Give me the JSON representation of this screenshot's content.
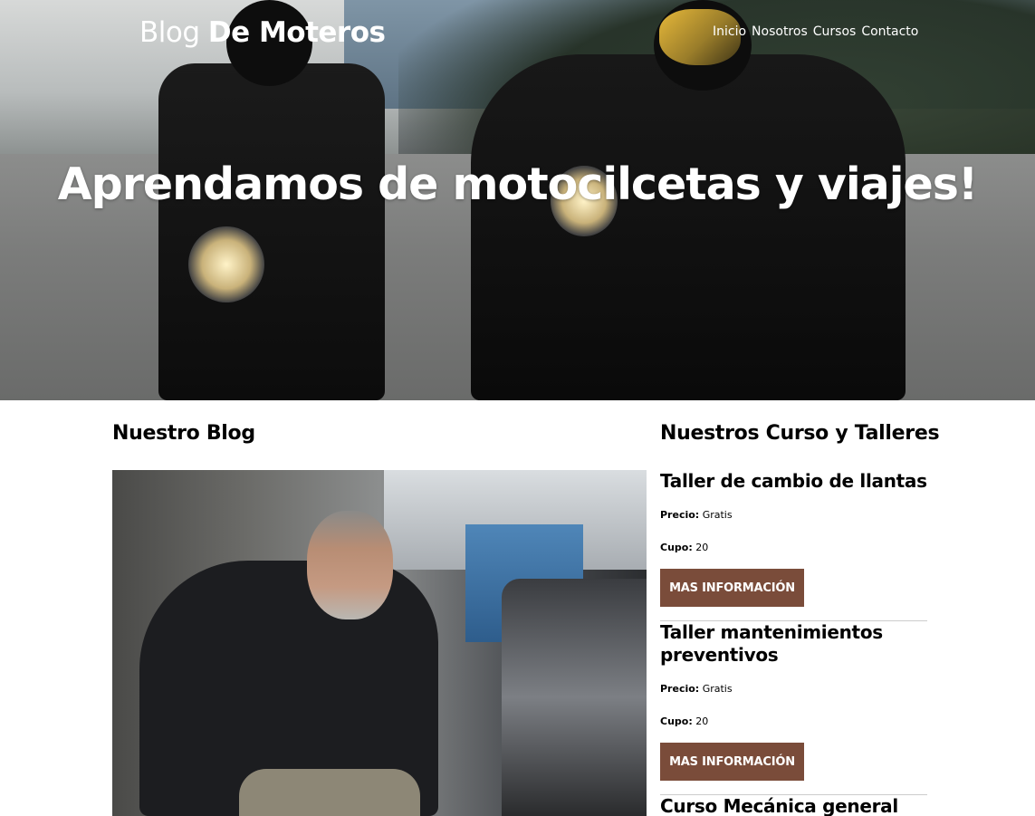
{
  "header": {
    "brand_light": "Blog ",
    "brand_bold": "De Moteros",
    "nav": [
      {
        "label": "Inicio"
      },
      {
        "label": "Nosotros"
      },
      {
        "label": "Cursos"
      },
      {
        "label": "Contacto"
      }
    ],
    "hero_title": "Aprendamos de motocilcetas y viajes!"
  },
  "blog": {
    "heading": "Nuestro Blog"
  },
  "courses": {
    "heading": "Nuestros Curso y Talleres",
    "price_label": "Precio:",
    "quota_label": "Cupo:",
    "button_label": "MAS INFORMACIÓN",
    "items": [
      {
        "title": "Taller de cambio de llantas",
        "price": "Gratis",
        "quota": "20"
      },
      {
        "title": "Taller mantenimientos preventivos",
        "price": "Gratis",
        "quota": "20"
      },
      {
        "title": "Curso Mecánica general"
      }
    ]
  },
  "colors": {
    "button_bg": "#7a4c3a",
    "text": "#000000",
    "hero_text": "#ffffff"
  }
}
